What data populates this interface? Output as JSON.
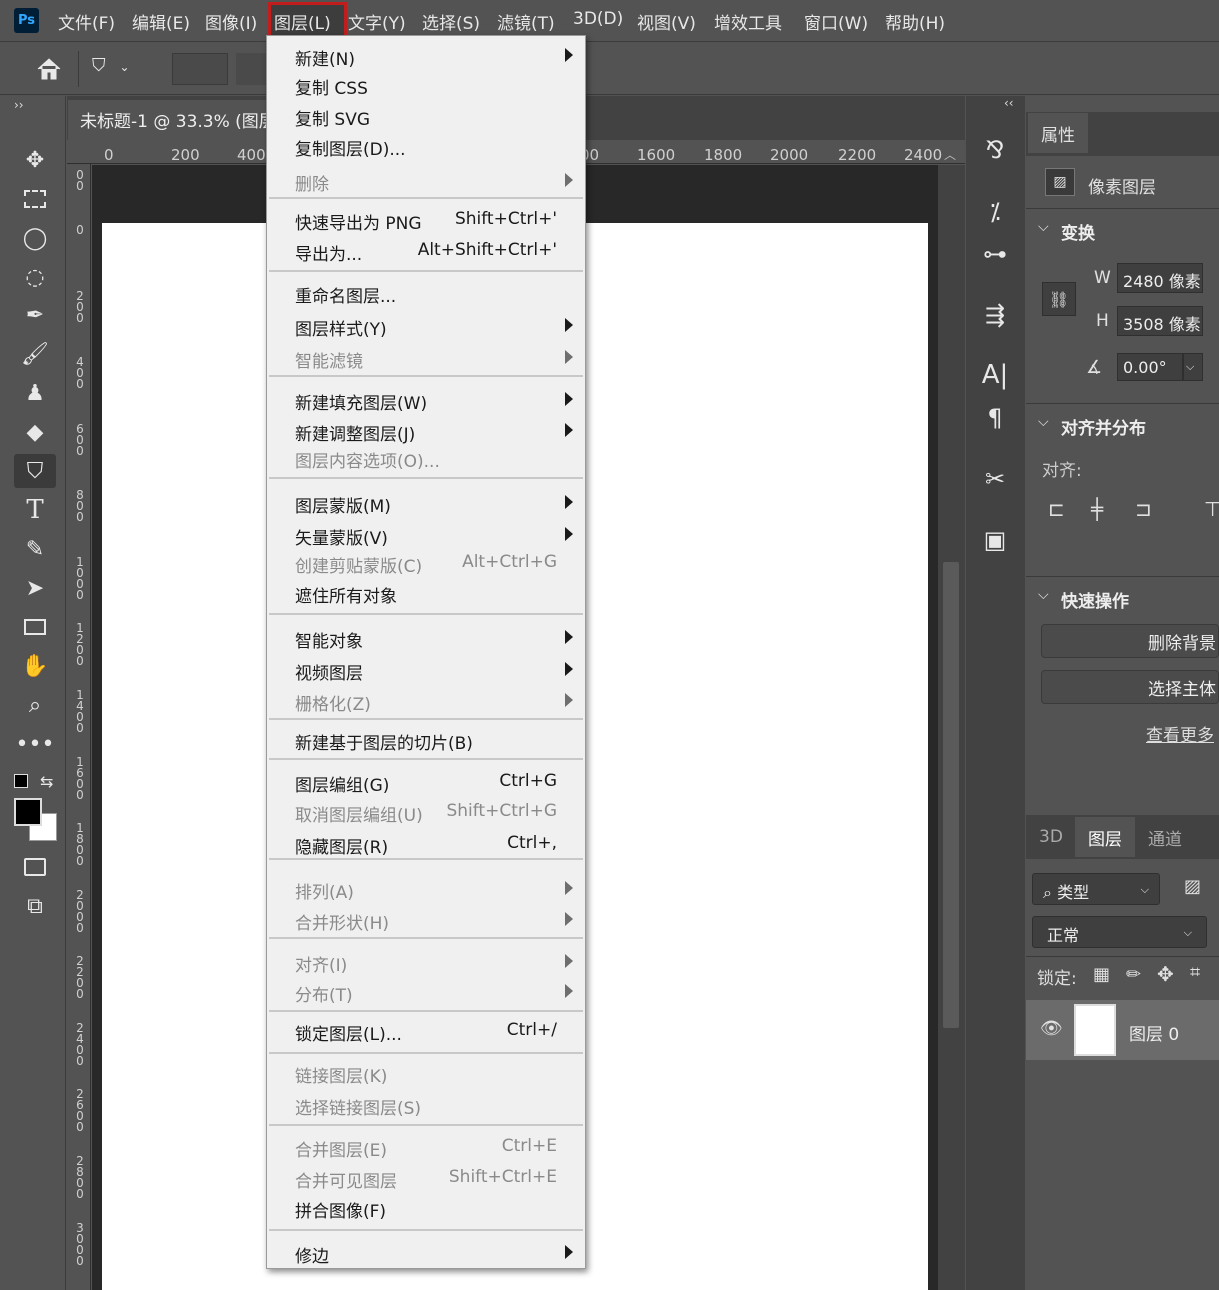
{
  "app": {
    "logo": "Ps"
  },
  "menubar": {
    "items": [
      "文件(F)",
      "编辑(E)",
      "图像(I)",
      "图层(L)",
      "文字(Y)",
      "选择(S)",
      "滤镜(T)",
      "3D(D)",
      "视图(V)",
      "增效工具",
      "窗口(W)",
      "帮助(H)"
    ],
    "active_index": 3
  },
  "document": {
    "tab_title": "未标题-1 @ 33.3% (图层",
    "ruler_h": [
      "0",
      "200",
      "400",
      "00",
      "1600",
      "1800",
      "2000",
      "2200",
      "2400"
    ],
    "ruler_v": [
      "0\n0",
      "0",
      "2\n0\n0",
      "4\n0\n0",
      "6\n0\n0",
      "8\n0\n0",
      "1\n0\n0\n0",
      "1\n2\n0\n0",
      "1\n4\n0\n0",
      "1\n6\n0\n0",
      "1\n8\n0\n0",
      "2\n0\n0\n0",
      "2\n2\n0\n0",
      "2\n4\n0\n0",
      "2\n6\n0\n0",
      "2\n8\n0\n0",
      "3\n0\n0\n0"
    ]
  },
  "layer_menu": {
    "items": [
      {
        "label": "新建(N)",
        "submenu": true
      },
      {
        "label": "复制 CSS"
      },
      {
        "label": "复制 SVG"
      },
      {
        "label": "复制图层(D)..."
      },
      {
        "label": "删除",
        "submenu": true,
        "disabled": true
      },
      {
        "label": "快速导出为 PNG",
        "shortcut": "Shift+Ctrl+'"
      },
      {
        "label": "导出为...",
        "shortcut": "Alt+Shift+Ctrl+'"
      },
      {
        "label": "重命名图层..."
      },
      {
        "label": "图层样式(Y)",
        "submenu": true
      },
      {
        "label": "智能滤镜",
        "submenu": true,
        "disabled": true
      },
      {
        "label": "新建填充图层(W)",
        "submenu": true
      },
      {
        "label": "新建调整图层(J)",
        "submenu": true
      },
      {
        "label": "图层内容选项(O)...",
        "disabled": true
      },
      {
        "label": "图层蒙版(M)",
        "submenu": true
      },
      {
        "label": "矢量蒙版(V)",
        "submenu": true
      },
      {
        "label": "创建剪贴蒙版(C)",
        "shortcut": "Alt+Ctrl+G",
        "disabled": true
      },
      {
        "label": "遮住所有对象"
      },
      {
        "label": "智能对象",
        "submenu": true
      },
      {
        "label": "视频图层",
        "submenu": true
      },
      {
        "label": "栅格化(Z)",
        "submenu": true,
        "disabled": true
      },
      {
        "label": "新建基于图层的切片(B)"
      },
      {
        "label": "图层编组(G)",
        "shortcut": "Ctrl+G"
      },
      {
        "label": "取消图层编组(U)",
        "shortcut": "Shift+Ctrl+G",
        "disabled": true
      },
      {
        "label": "隐藏图层(R)",
        "shortcut": "Ctrl+,"
      },
      {
        "label": "排列(A)",
        "submenu": true,
        "disabled": true
      },
      {
        "label": "合并形状(H)",
        "submenu": true,
        "disabled": true
      },
      {
        "label": "对齐(I)",
        "submenu": true,
        "disabled": true
      },
      {
        "label": "分布(T)",
        "submenu": true,
        "disabled": true
      },
      {
        "label": "锁定图层(L)...",
        "shortcut": "Ctrl+/"
      },
      {
        "label": "链接图层(K)",
        "disabled": true
      },
      {
        "label": "选择链接图层(S)",
        "disabled": true
      },
      {
        "label": "合并图层(E)",
        "shortcut": "Ctrl+E",
        "disabled": true
      },
      {
        "label": "合并可见图层",
        "shortcut": "Shift+Ctrl+E",
        "disabled": true
      },
      {
        "label": "拼合图像(F)"
      },
      {
        "label": "修边",
        "submenu": true
      }
    ]
  },
  "properties_panel": {
    "tab": "属性",
    "layer_type": "像素图层",
    "transform_title": "变换",
    "w_label": "W",
    "w_value": "2480 像素",
    "h_label": "H",
    "h_value": "3508 像素",
    "angle_value": "0.00°",
    "align_title": "对齐并分布",
    "align_label": "对齐:",
    "quick_title": "快速操作",
    "remove_bg": "删除背景",
    "select_subject": "选择主体",
    "see_more": "查看更多"
  },
  "layers_panel": {
    "tabs": [
      "3D",
      "图层",
      "通道"
    ],
    "active_tab": 1,
    "filter_label": "类型",
    "blend_mode": "正常",
    "lock_label": "锁定:",
    "layer_name": "图层 0"
  },
  "colors": {
    "accent_red": "#c21d1d",
    "ps_blue": "#31a8ff"
  }
}
